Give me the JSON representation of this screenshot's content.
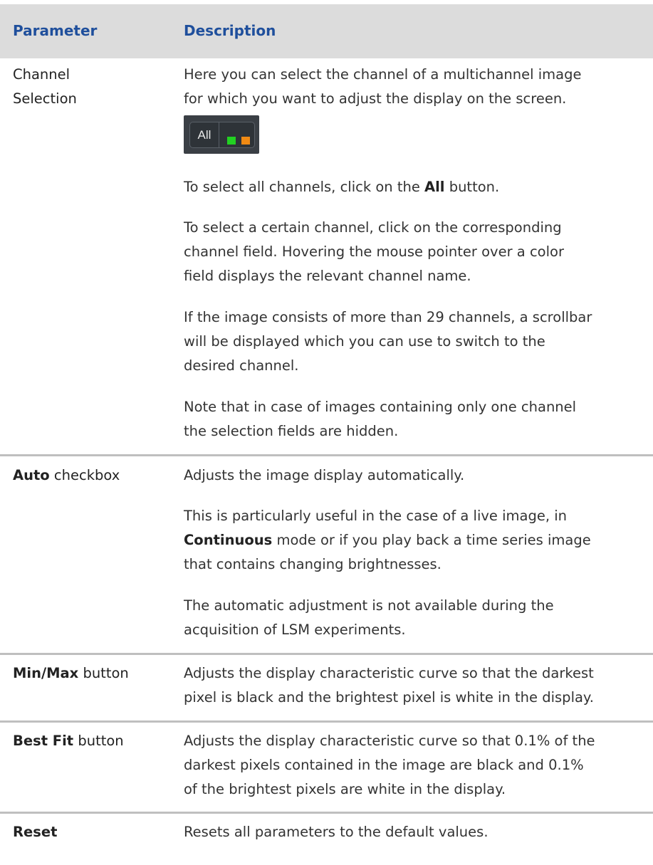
{
  "table": {
    "headers": {
      "parameter": "Parameter",
      "description": "Description"
    },
    "rows": [
      {
        "label": "Channel Selection",
        "label_line1": "Channel",
        "label_line2": "Selection",
        "widget": {
          "all_label": "All",
          "channel_colors": [
            "#22d122",
            "#f08a14"
          ]
        },
        "paragraphs": [
          {
            "l1": "Here you can select the channel of a multichannel image",
            "l2": "for which you want to adjust the display on the screen."
          },
          {
            "pre": "To select all channels, click on the ",
            "bold": "All",
            "post": " button."
          },
          {
            "l1": "To select a certain channel, click on the corresponding",
            "l2": "channel field. Hovering the mouse pointer over a color",
            "l3": "field displays the relevant channel name."
          },
          {
            "l1": "If the image consists of more than 29 channels, a scrollbar",
            "l2": "will be displayed which you can use to switch to the",
            "l3": "desired channel."
          },
          {
            "l1": "Note that in case of images containing only one channel",
            "l2": "the selection fields are hidden."
          }
        ]
      },
      {
        "label_bold": "Auto",
        "label_rest": " checkbox",
        "paragraphs": [
          {
            "l1": "Adjusts the image display automatically."
          },
          {
            "l1": "This is particularly useful in the case of a live image, in",
            "l2_bold": "Continuous",
            "l2_rest": " mode or if you play back a time series image",
            "l3": "that contains changing brightnesses."
          },
          {
            "l1": "The automatic adjustment is not available during the",
            "l2": "acquisition of LSM experiments."
          }
        ]
      },
      {
        "label_bold": "Min/Max",
        "label_rest": " button",
        "paragraphs": [
          {
            "l1": "Adjusts the display characteristic curve so that the darkest",
            "l2": "pixel is black and the brightest pixel is white in the display."
          }
        ]
      },
      {
        "label_bold": "Best Fit",
        "label_rest": " button",
        "paragraphs": [
          {
            "l1": "Adjusts the display characteristic curve so that 0.1% of the",
            "l2": "darkest pixels contained in the image are black and 0.1%",
            "l3": "of the brightest pixels are white in the display."
          }
        ]
      },
      {
        "label_bold": "Reset",
        "paragraphs": [
          {
            "l1": "Resets all parameters to the default values."
          }
        ]
      }
    ]
  },
  "colors": {
    "header_text": "#1f4f9c",
    "header_bg": "#dcdcdc",
    "separator": "#bfbfbf"
  }
}
